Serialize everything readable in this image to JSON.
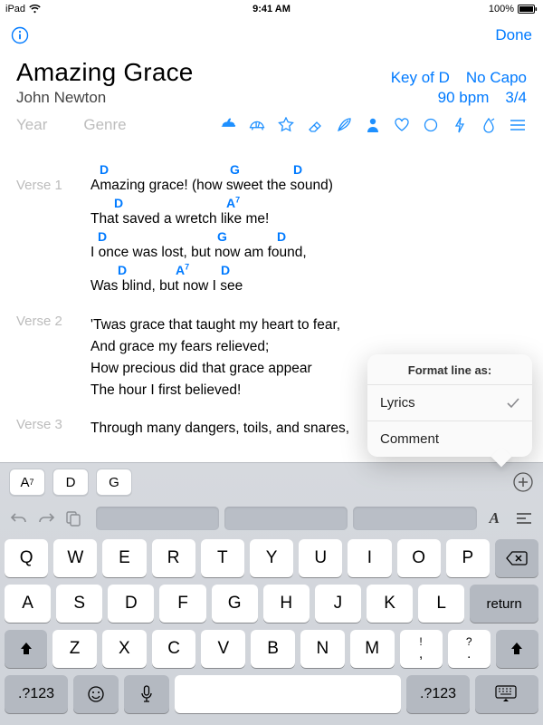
{
  "status": {
    "device": "iPad",
    "time": "9:41 AM",
    "battery": "100%"
  },
  "nav": {
    "done": "Done"
  },
  "song": {
    "title": "Amazing Grace",
    "artist": "John Newton",
    "key": "Key of D",
    "capo": "No Capo",
    "tempo": "90 bpm",
    "signature": "3/4",
    "year_placeholder": "Year",
    "genre_placeholder": "Genre"
  },
  "verses": [
    {
      "label": "Verse 1",
      "lines": [
        {
          "text": "Amazing grace! (how sweet the sound)",
          "chords": [
            [
              "D",
              10
            ],
            [
              "G",
              154
            ],
            [
              "D",
              224
            ]
          ]
        },
        {
          "text": "That saved a wretch like me!",
          "chords": [
            [
              "D",
              26
            ],
            [
              "A7",
              150
            ]
          ]
        },
        {
          "text": "I once was lost, but now am found,",
          "chords": [
            [
              "D",
              8
            ],
            [
              "G",
              140
            ],
            [
              "D",
              206
            ]
          ]
        },
        {
          "text": "Was blind, but now I see",
          "chords": [
            [
              "D",
              30
            ],
            [
              "A7",
              94
            ],
            [
              "D",
              144
            ]
          ]
        }
      ]
    },
    {
      "label": "Verse 2",
      "lines": [
        {
          "text": "'Twas grace that taught my heart to fear,"
        },
        {
          "text": "And grace my fears relieved;"
        },
        {
          "text": "How precious did that grace appear"
        },
        {
          "text": "The hour I first believed!"
        }
      ]
    },
    {
      "label": "Verse 3",
      "lines": [
        {
          "text": "Through many dangers, toils, and snares,"
        }
      ]
    }
  ],
  "popover": {
    "title": "Format line as:",
    "opt1": "Lyrics",
    "opt2": "Comment"
  },
  "chord_shortcuts": [
    "A7",
    "D",
    "G"
  ],
  "keyboard": {
    "row1": [
      "Q",
      "W",
      "E",
      "R",
      "T",
      "Y",
      "U",
      "I",
      "O",
      "P"
    ],
    "row2": [
      "A",
      "S",
      "D",
      "F",
      "G",
      "H",
      "J",
      "K",
      "L"
    ],
    "row3": [
      "Z",
      "X",
      "C",
      "V",
      "B",
      "N",
      "M"
    ],
    "punct1top": "!",
    "punct1bot": ",",
    "punct2top": "?",
    "punct2bot": ".",
    "numkey": ".?123",
    "return": "return"
  }
}
